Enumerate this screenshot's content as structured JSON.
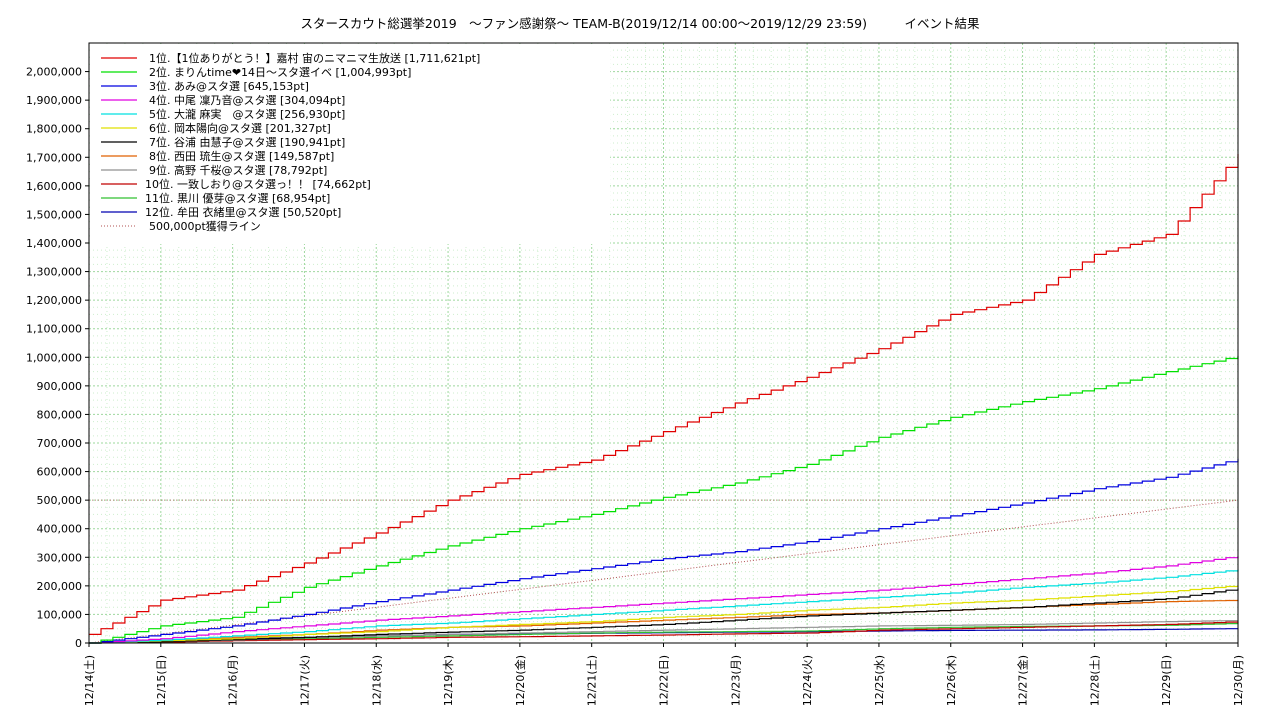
{
  "chart_data": {
    "type": "line",
    "title": "スタースカウト総選挙2019　～ファン感謝祭～ TEAM-B(2019/12/14 00:00～2019/12/29 23:59)　　　イベント結果",
    "xlabel": "",
    "ylabel": "",
    "ylim": [
      0,
      2100000
    ],
    "y_ticks": [
      "0",
      "100,000",
      "200,000",
      "300,000",
      "400,000",
      "500,000",
      "600,000",
      "700,000",
      "800,000",
      "900,000",
      "1,000,000",
      "1,100,000",
      "1,200,000",
      "1,300,000",
      "1,400,000",
      "1,500,000",
      "1,600,000",
      "1,700,000",
      "1,800,000",
      "1,900,000",
      "2,000,000"
    ],
    "x_ticks": [
      "12/14(土)",
      "12/15(日)",
      "12/16(月)",
      "12/17(火)",
      "12/18(水)",
      "12/19(木)",
      "12/20(金)",
      "12/21(土)",
      "12/22(日)",
      "12/23(月)",
      "12/24(火)",
      "12/25(水)",
      "12/26(木)",
      "12/27(金)",
      "12/28(土)",
      "12/29(日)",
      "12/30(月)"
    ],
    "grid": true,
    "legend_position": "top-left",
    "reference_line": {
      "name": "500,000pt獲得ライン",
      "color": "#b05050",
      "end_value": 500000
    },
    "series": [
      {
        "name": "1位.【1位ありがとう！】嘉村 宙のニマニマ生放送 [1,711,621pt]",
        "color": "#e00000",
        "values": [
          30000,
          150000,
          185000,
          280000,
          385000,
          500000,
          590000,
          640000,
          740000,
          840000,
          930000,
          1030000,
          1150000,
          1200000,
          1360000,
          1430000,
          1711621
        ]
      },
      {
        "name": "2位. まりんtime❤14日～スタ選イベ [1,004,993pt]",
        "color": "#00e000",
        "values": [
          0,
          60000,
          90000,
          195000,
          270000,
          340000,
          400000,
          450000,
          510000,
          560000,
          625000,
          720000,
          790000,
          845000,
          890000,
          950000,
          1004993
        ]
      },
      {
        "name": "3位. あみ@スタ選 [645,153pt]",
        "color": "#0000e0",
        "values": [
          0,
          30000,
          60000,
          100000,
          145000,
          185000,
          225000,
          260000,
          295000,
          320000,
          355000,
          400000,
          445000,
          490000,
          540000,
          580000,
          645153
        ]
      },
      {
        "name": "4位. 中尾 凜乃音@スタ選 [304,094pt]",
        "color": "#e000e0",
        "values": [
          0,
          15000,
          40000,
          60000,
          80000,
          95000,
          110000,
          125000,
          140000,
          155000,
          170000,
          185000,
          205000,
          225000,
          245000,
          270000,
          304094
        ]
      },
      {
        "name": "5位. 大瀧 麻実　@スタ選 [256,930pt]",
        "color": "#00e0e0",
        "values": [
          0,
          10000,
          25000,
          40000,
          60000,
          70000,
          85000,
          100000,
          115000,
          130000,
          145000,
          160000,
          175000,
          195000,
          210000,
          230000,
          256930
        ]
      },
      {
        "name": "6位. 岡本陽向@スタ選 [201,327pt]",
        "color": "#e0e000",
        "values": [
          0,
          8000,
          15000,
          30000,
          40000,
          55000,
          65000,
          75000,
          90000,
          100000,
          115000,
          125000,
          140000,
          150000,
          165000,
          180000,
          201327
        ]
      },
      {
        "name": "7位. 谷浦 由慧子@スタ選 [190,941pt]",
        "color": "#000000",
        "values": [
          0,
          5000,
          12000,
          20000,
          30000,
          38000,
          45000,
          55000,
          65000,
          80000,
          95000,
          105000,
          115000,
          125000,
          140000,
          155000,
          190941
        ]
      },
      {
        "name": "8位. 西田 琉生@スタ選 [149,587pt]",
        "color": "#e06000",
        "values": [
          0,
          5000,
          20000,
          30000,
          45000,
          55000,
          60000,
          70000,
          80000,
          90000,
          100000,
          105000,
          115000,
          125000,
          135000,
          145000,
          149587
        ]
      },
      {
        "name": "9位. 高野 千桜@スタ選 [78,792pt]",
        "color": "#909090",
        "values": [
          0,
          5000,
          10000,
          20000,
          25000,
          30000,
          35000,
          40000,
          45000,
          50000,
          55000,
          60000,
          62000,
          65000,
          70000,
          75000,
          78792
        ]
      },
      {
        "name": "10位. 一致しおり@スタ選っ！！ [74,662pt]",
        "color": "#c00000",
        "values": [
          0,
          3000,
          8000,
          12000,
          15000,
          20000,
          22000,
          25000,
          28000,
          32000,
          35000,
          45000,
          50000,
          55000,
          60000,
          65000,
          74662
        ]
      },
      {
        "name": "11位. 黒川 優芽@スタ選 [68,954pt]",
        "color": "#30c030",
        "values": [
          0,
          5000,
          10000,
          15000,
          20000,
          25000,
          30000,
          35000,
          38000,
          40000,
          42000,
          50000,
          55000,
          58000,
          60000,
          62000,
          68954
        ]
      },
      {
        "name": "12位. 牟田 衣緒里@スタ選 [50,520pt]",
        "color": "#0000b0",
        "values": [
          0,
          10000,
          15000,
          20000,
          25000,
          30000,
          32000,
          34000,
          36000,
          38000,
          40000,
          42000,
          44000,
          45000,
          46000,
          48000,
          50520
        ]
      }
    ]
  }
}
